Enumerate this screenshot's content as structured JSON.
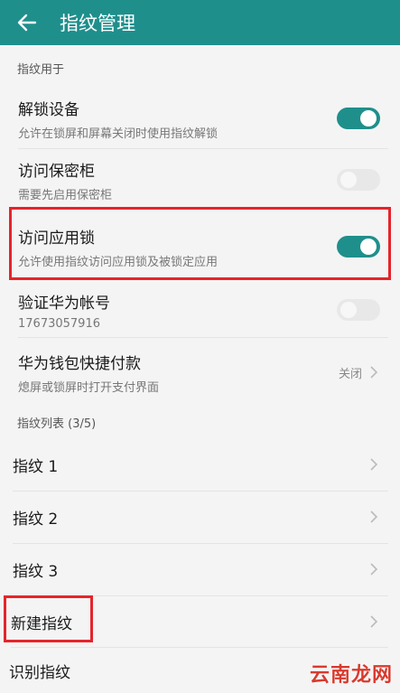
{
  "appbar": {
    "title": "指纹管理"
  },
  "sections": {
    "usage_header": "指纹用于",
    "list_header": "指纹列表 (3/5)"
  },
  "settings": {
    "unlock": {
      "title": "解锁设备",
      "subtitle": "允许在锁屏和屏幕关闭时使用指纹解锁",
      "enabled": true
    },
    "safe": {
      "title": "访问保密柜",
      "subtitle": "需要先启用保密柜",
      "enabled": false
    },
    "app_lock": {
      "title": "访问应用锁",
      "subtitle": "允许使用指纹访问应用锁及被锁定应用",
      "enabled": true
    },
    "huawei_id": {
      "title": "验证华为帐号",
      "subtitle": "17673057916",
      "enabled": false
    },
    "wallet": {
      "title": "华为钱包快捷付款",
      "subtitle": "熄屏或锁屏时打开支付界面",
      "value": "关闭"
    }
  },
  "fingerprints": [
    {
      "label": "指纹 1"
    },
    {
      "label": "指纹 2"
    },
    {
      "label": "指纹 3"
    }
  ],
  "actions": {
    "new": "新建指纹",
    "identify": "识别指纹"
  },
  "watermark": "云南龙网",
  "colors": {
    "accent": "#1f8f8c",
    "highlight": "#e5242b"
  }
}
